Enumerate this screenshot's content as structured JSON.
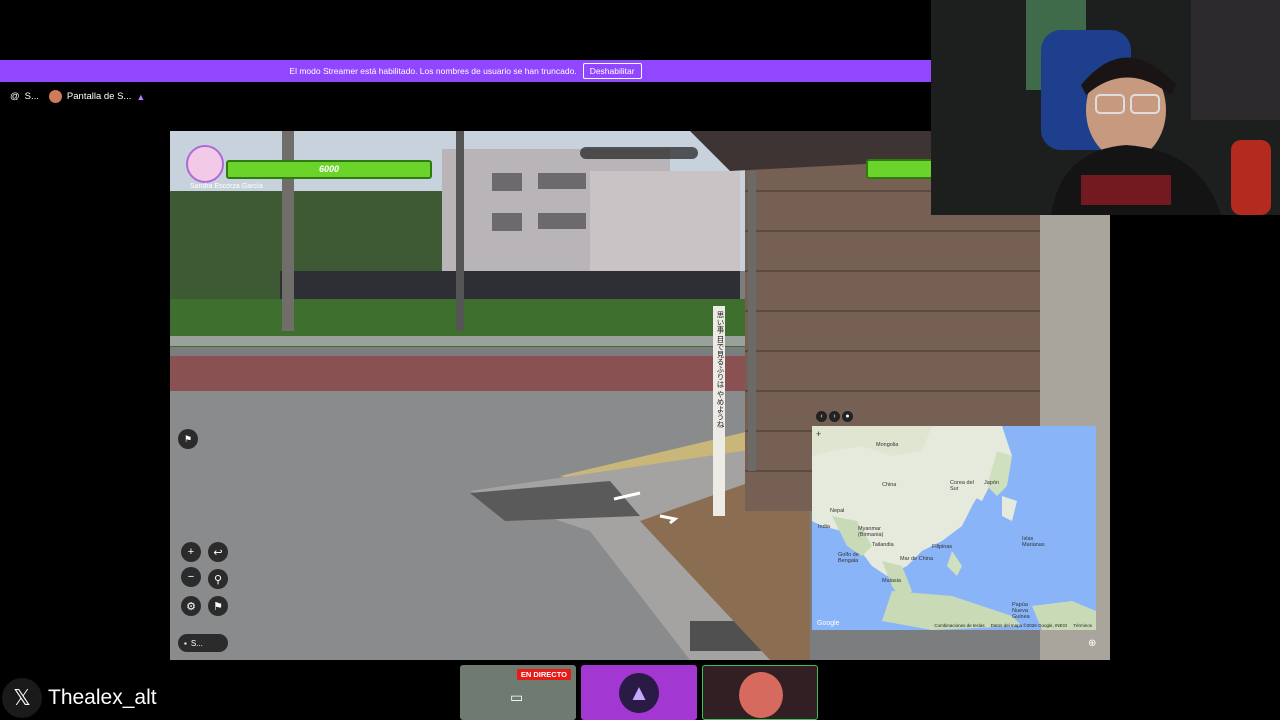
{
  "banner": {
    "message": "El modo Streamer está habilitado. Los nombres de usuario se han truncado.",
    "button_label": "Deshabilitar"
  },
  "breadcrumb": {
    "server_label": "S...",
    "screen_label": "Pantalla de S..."
  },
  "game": {
    "player_hp": "6000",
    "player_name": "Sandra Escorza García",
    "pole_sign": "思い事 目で見るふりは やめようね",
    "controls": [
      "+",
      "−",
      "↩",
      "⚲",
      "⚙",
      "⚑"
    ],
    "chat_label": "S..."
  },
  "minimap": {
    "zoom_in": "+",
    "labels": [
      "Mongolia",
      "China",
      "Corea del Sur",
      "Japón",
      "Nepal",
      "India",
      "Myanmar (Birmania)",
      "Tailandia",
      "Golfo de Bengala",
      "Mar de China",
      "Filipinas",
      "Malasia",
      "Papúa Nueva Guinea",
      "Islas Marianas"
    ],
    "footer": [
      "Combinaciones de teclas",
      "Datos del mapa ©2026 Google, INEGI",
      "Términos"
    ],
    "logo": "Google"
  },
  "dock": {
    "live_badge": "EN DIRECTO"
  },
  "social": {
    "x_handle": "Thealex_alt"
  },
  "colors": {
    "banner": "#9146ff",
    "health": "#6bd42a",
    "live": "#e91916"
  }
}
